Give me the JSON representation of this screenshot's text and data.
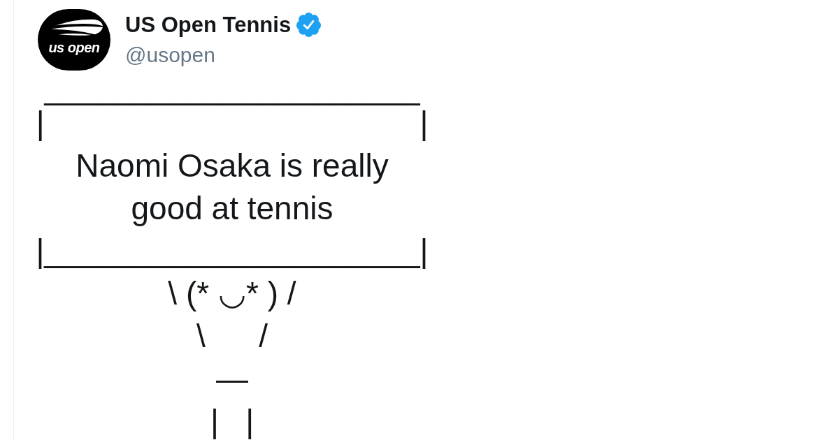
{
  "tweet": {
    "author": {
      "avatar": {
        "logo_text": "us open"
      },
      "name": "US Open Tennis",
      "verified": true,
      "handle": "@usopen"
    },
    "text_lines": [
      "_____________________",
      "|                                          |",
      "Naomi Osaka is really",
      "good at tennis",
      "|_____________________|",
      "\\ (* ◡* ) /",
      "\\      /",
      "—",
      "|   |"
    ]
  }
}
